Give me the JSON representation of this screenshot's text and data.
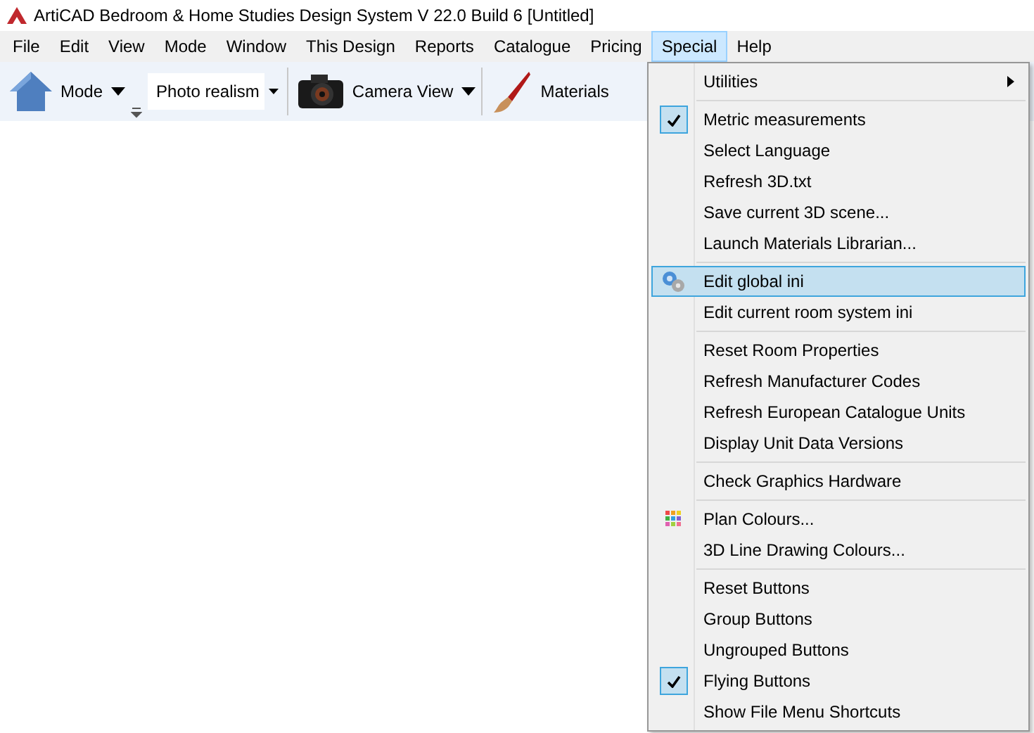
{
  "window": {
    "title": "ArtiCAD Bedroom & Home Studies Design System  V 22.0 Build 6  [Untitled]"
  },
  "menu_bar": [
    {
      "label": "File",
      "selected": false
    },
    {
      "label": "Edit",
      "selected": false
    },
    {
      "label": "View",
      "selected": false
    },
    {
      "label": "Mode",
      "selected": false
    },
    {
      "label": "Window",
      "selected": false
    },
    {
      "label": "This Design",
      "selected": false
    },
    {
      "label": "Reports",
      "selected": false
    },
    {
      "label": "Catalogue",
      "selected": false
    },
    {
      "label": "Pricing",
      "selected": false
    },
    {
      "label": "Special",
      "selected": true
    },
    {
      "label": "Help",
      "selected": false
    }
  ],
  "toolbar": {
    "mode_button": {
      "label": "Mode"
    },
    "render_combo": {
      "value": "Photo realism"
    },
    "camera_button": {
      "label": "Camera View"
    },
    "materials_button": {
      "label": "Materials"
    }
  },
  "special_menu": {
    "groups": [
      [
        {
          "label": "Utilities",
          "kind": "submenu",
          "checked": false,
          "selected": false
        }
      ],
      [
        {
          "label": "Metric measurements",
          "kind": "plain",
          "checked": true,
          "selected": false
        },
        {
          "label": "Select Language",
          "kind": "plain",
          "checked": false,
          "selected": false
        },
        {
          "label": "Refresh 3D.txt",
          "kind": "plain",
          "checked": false,
          "selected": false
        },
        {
          "label": "Save current 3D scene...",
          "kind": "plain",
          "checked": false,
          "selected": false
        },
        {
          "label": "Launch Materials Librarian...",
          "kind": "plain",
          "checked": false,
          "selected": false
        }
      ],
      [
        {
          "label": "Edit global ini",
          "kind": "gear",
          "checked": false,
          "selected": true
        },
        {
          "label": "Edit current room system ini",
          "kind": "plain",
          "checked": false,
          "selected": false
        }
      ],
      [
        {
          "label": "Reset Room Properties",
          "kind": "plain",
          "checked": false,
          "selected": false
        },
        {
          "label": "Refresh Manufacturer Codes",
          "kind": "plain",
          "checked": false,
          "selected": false
        },
        {
          "label": "Refresh European Catalogue Units",
          "kind": "plain",
          "checked": false,
          "selected": false
        },
        {
          "label": "Display Unit Data Versions",
          "kind": "plain",
          "checked": false,
          "selected": false
        }
      ],
      [
        {
          "label": "Check Graphics Hardware",
          "kind": "plain",
          "checked": false,
          "selected": false
        }
      ],
      [
        {
          "label": "Plan Colours...",
          "kind": "palette",
          "checked": false,
          "selected": false
        },
        {
          "label": "3D Line Drawing Colours...",
          "kind": "plain",
          "checked": false,
          "selected": false
        }
      ],
      [
        {
          "label": "Reset Buttons",
          "kind": "plain",
          "checked": false,
          "selected": false
        },
        {
          "label": "Group Buttons",
          "kind": "plain",
          "checked": false,
          "selected": false
        },
        {
          "label": "Ungrouped Buttons",
          "kind": "plain",
          "checked": false,
          "selected": false
        },
        {
          "label": "Flying Buttons",
          "kind": "plain",
          "checked": true,
          "selected": false
        },
        {
          "label": "Show File Menu Shortcuts",
          "kind": "plain",
          "checked": false,
          "selected": false
        }
      ]
    ]
  }
}
